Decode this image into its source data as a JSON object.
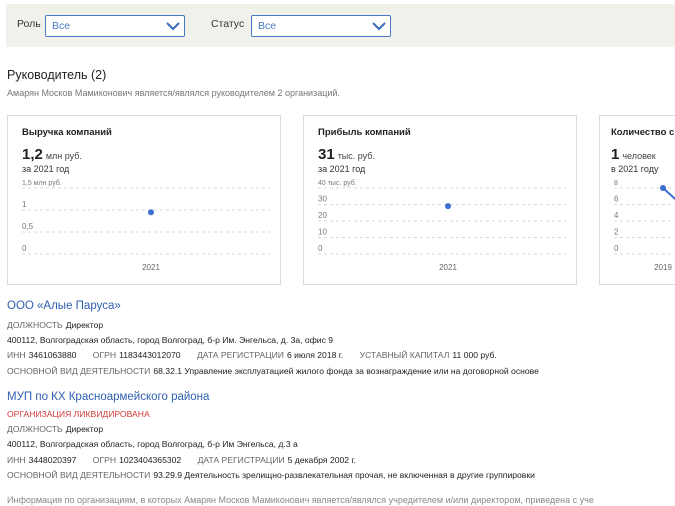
{
  "filters": {
    "role": {
      "label": "Роль",
      "value": "Все"
    },
    "status": {
      "label": "Статус",
      "value": "Все"
    }
  },
  "section": {
    "title": "Руководитель (2)",
    "subtitle": "Амарян Москов Мамиконович является/являлся руководителем 2 организаций."
  },
  "cards": [
    {
      "title": "Выручка компаний",
      "value": "1,2",
      "unit": "млн руб.",
      "period": "за 2021 год"
    },
    {
      "title": "Прибыль компаний",
      "value": "31",
      "unit": "тыс. руб.",
      "period": "за 2021 год"
    },
    {
      "title": "Количество с",
      "value": "1",
      "unit": "человек",
      "period": "в 2021 году"
    }
  ],
  "chart_data": [
    {
      "type": "scatter",
      "title": "Выручка компаний",
      "ylabel": "млн руб.",
      "x": [
        "2021"
      ],
      "values": [
        0.95
      ],
      "ylim": [
        0,
        1.5
      ],
      "yticks": [
        "1,5 млн руб.",
        "1",
        "0,5",
        "0"
      ],
      "grid": true
    },
    {
      "type": "scatter",
      "title": "Прибыль компаний",
      "ylabel": "тыс. руб.",
      "x": [
        "2021"
      ],
      "values": [
        29
      ],
      "ylim": [
        0,
        40
      ],
      "yticks": [
        "40 тыс. руб.",
        "30",
        "20",
        "10",
        "0"
      ],
      "grid": true
    },
    {
      "type": "line",
      "title": "Количество с",
      "ylabel": "человек",
      "x": [
        "2019"
      ],
      "values": [
        8
      ],
      "ylim": [
        0,
        8
      ],
      "yticks": [
        "8",
        "6",
        "4",
        "2",
        "0"
      ],
      "grid": true
    }
  ],
  "orgs": [
    {
      "name": "ООО «Алые Паруса»",
      "position_label": "ДОЛЖНОСТЬ",
      "position": "Директор",
      "address": "400112, Волгоградская область, город Волгоград, б-р Им. Энгельса, д. 3а, офис 9",
      "inn_label": "ИНН",
      "inn": "3461063880",
      "ogrn_label": "ОГРН",
      "ogrn": "1183443012070",
      "reg_label": "ДАТА РЕГИСТРАЦИИ",
      "reg": "6 июля 2018 г.",
      "capital_label": "УСТАВНЫЙ КАПИТАЛ",
      "capital": "11 000 руб.",
      "activity_label": "ОСНОВНОЙ ВИД ДЕЯТЕЛЬНОСТИ",
      "activity": "68.32.1 Управление эксплуатацией жилого фонда за вознаграждение или на договорной основе"
    },
    {
      "name": "МУП по КХ Красноармейского района",
      "status": "ОРГАНИЗАЦИЯ ЛИКВИДИРОВАНА",
      "position_label": "ДОЛЖНОСТЬ",
      "position": "Директор",
      "address": "400112, Волгоградская область, город Волгоград, б-р Им Энгельса, д.3 а",
      "inn_label": "ИНН",
      "inn": "3448020397",
      "ogrn_label": "ОГРН",
      "ogrn": "1023404365302",
      "reg_label": "ДАТА РЕГИСТРАЦИИ",
      "reg": "5 декабря 2002 г.",
      "activity_label": "ОСНОВНОЙ ВИД ДЕЯТЕЛЬНОСТИ",
      "activity": "93.29.9 Деятельность зрелищно-развлекательная прочая, не включенная в другие группировки"
    }
  ],
  "footer": "Информация по организациям, в которых Амарян Москов Мамиконович является/являлся учредителем и/или директором, приведена с уче",
  "colors": {
    "accent": "#4a78c2",
    "link": "#2f5fb0",
    "danger": "#d23a3a",
    "point": "#3a6fd0"
  }
}
